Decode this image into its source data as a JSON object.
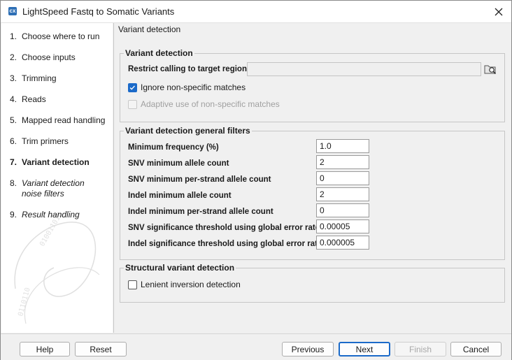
{
  "window": {
    "title": "LightSpeed Fastq to Somatic Variants",
    "icon_text": "cx"
  },
  "steps": [
    {
      "num": "1.",
      "label": "Choose where to run"
    },
    {
      "num": "2.",
      "label": "Choose inputs"
    },
    {
      "num": "3.",
      "label": "Trimming"
    },
    {
      "num": "4.",
      "label": "Reads"
    },
    {
      "num": "5.",
      "label": "Mapped read handling"
    },
    {
      "num": "6.",
      "label": "Trim primers"
    },
    {
      "num": "7.",
      "label": "Variant detection"
    },
    {
      "num": "8.",
      "label": "Variant detection noise filters"
    },
    {
      "num": "9.",
      "label": "Result handling"
    }
  ],
  "content": {
    "section_title": "Variant detection",
    "variant_detection": {
      "legend": "Variant detection",
      "restrict_label": "Restrict calling to target regions",
      "restrict_value": "",
      "ignore_label": "Ignore non-specific matches",
      "ignore_checked": true,
      "adaptive_label": "Adaptive use of non-specific matches",
      "adaptive_checked": false
    },
    "general_filters": {
      "legend": "Variant detection general filters",
      "rows": [
        {
          "label": "Minimum frequency (%)",
          "value": "1.0"
        },
        {
          "label": "SNV minimum allele count",
          "value": "2"
        },
        {
          "label": "SNV minimum per-strand allele count",
          "value": "0"
        },
        {
          "label": "Indel minimum allele count",
          "value": "2"
        },
        {
          "label": "Indel minimum per-strand allele count",
          "value": "0"
        },
        {
          "label": "SNV significance threshold using global error rate",
          "value": "0.00005"
        },
        {
          "label": "Indel significance threshold using global error rate",
          "value": "0.000005"
        }
      ]
    },
    "structural": {
      "legend": "Structural variant detection",
      "lenient_label": "Lenient inversion detection",
      "lenient_checked": false
    }
  },
  "footer": {
    "help": "Help",
    "reset": "Reset",
    "previous": "Previous",
    "next": "Next",
    "finish": "Finish",
    "cancel": "Cancel"
  },
  "colors": {
    "accent": "#1b6ac9",
    "app_icon": "#2e6fb5"
  }
}
